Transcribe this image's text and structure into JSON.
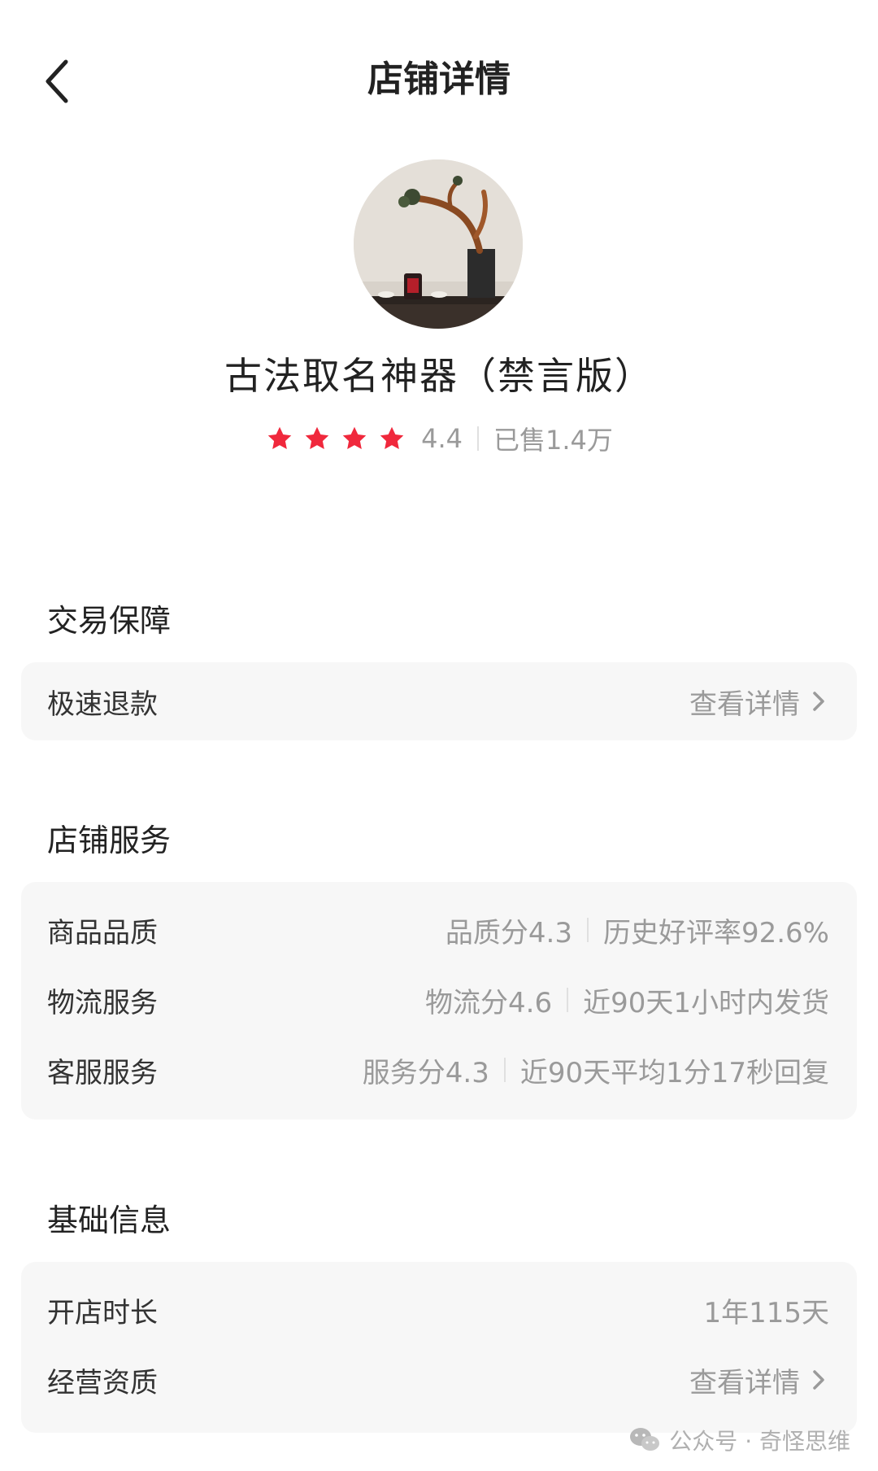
{
  "header": {
    "title": "店铺详情"
  },
  "shop": {
    "name": "古法取名神器（禁言版）",
    "rating": "4.4",
    "stars": 4,
    "sold": "已售1.4万"
  },
  "sections": {
    "trade": {
      "title": "交易保障",
      "rows": [
        {
          "label": "极速退款",
          "value": "查看详情"
        }
      ]
    },
    "service": {
      "title": "店铺服务",
      "rows": [
        {
          "label": "商品品质",
          "score": "品质分4.3",
          "detail": "历史好评率92.6%"
        },
        {
          "label": "物流服务",
          "score": "物流分4.6",
          "detail": "近90天1小时内发货"
        },
        {
          "label": "客服服务",
          "score": "服务分4.3",
          "detail": "近90天平均1分17秒回复"
        }
      ]
    },
    "basic": {
      "title": "基础信息",
      "rows": [
        {
          "label": "开店时长",
          "value": "1年115天"
        },
        {
          "label": "经营资质",
          "value": "查看详情"
        }
      ]
    }
  },
  "watermark": {
    "text": "公众号 · 奇怪思维"
  },
  "colors": {
    "star": "#f0283c",
    "muted": "#9a9a9a",
    "card_bg": "#f7f7f7"
  },
  "icons": {
    "back": "chevron-left-icon",
    "star": "star-icon",
    "detail": "chevron-right-icon",
    "watermark": "wechat-icon"
  }
}
